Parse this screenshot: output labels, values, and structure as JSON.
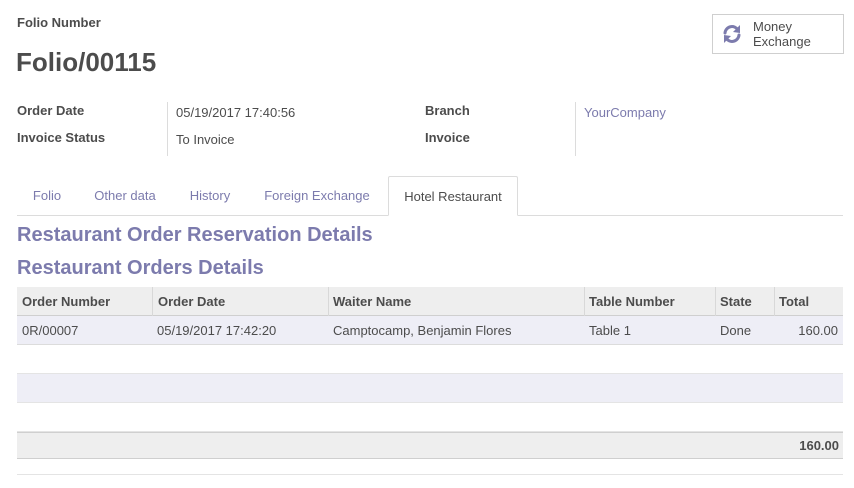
{
  "folio": {
    "label": "Folio Number",
    "number": "Folio/00115"
  },
  "money_exchange": {
    "line1": "Money",
    "line2": "Exchange",
    "icon": "refresh-icon",
    "icon_color": "#7c7bad"
  },
  "fields": {
    "order_date_label": "Order Date",
    "order_date_value": "05/19/2017 17:40:56",
    "invoice_status_label": "Invoice Status",
    "invoice_status_value": "To Invoice",
    "branch_label": "Branch",
    "branch_value": "YourCompany",
    "invoice_label": "Invoice",
    "invoice_value": ""
  },
  "tabs": [
    {
      "label": "Folio",
      "active": false
    },
    {
      "label": "Other data",
      "active": false
    },
    {
      "label": "History",
      "active": false
    },
    {
      "label": "Foreign Exchange",
      "active": false
    },
    {
      "label": "Hotel Restaurant",
      "active": true
    }
  ],
  "sections": {
    "reservation_title": "Restaurant Order Reservation Details",
    "orders_title": "Restaurant Orders Details"
  },
  "orders_table": {
    "columns": [
      "Order Number",
      "Order Date",
      "Waiter Name",
      "Table Number",
      "State",
      "Total"
    ],
    "rows": [
      [
        "0R/00007",
        "05/19/2017 17:42:20",
        "Camptocamp, Benjamin Flores",
        "Table 1",
        "Done",
        "160.00"
      ]
    ],
    "footer_total": "160.00"
  },
  "colors": {
    "accent": "#7c7bad",
    "text": "#4c4c4c",
    "header_bg": "#eeeeee",
    "row_highlight": "#eeeef6"
  }
}
